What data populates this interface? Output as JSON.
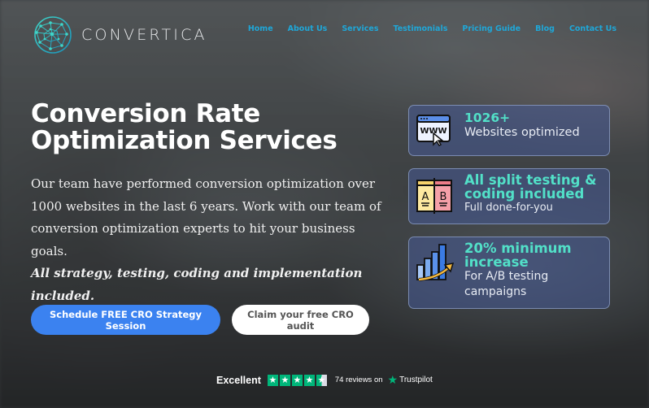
{
  "brand": {
    "name": "CONVERTICA",
    "logo_icon": "network-globe-icon"
  },
  "nav": {
    "items": [
      {
        "label": "Home"
      },
      {
        "label": "About Us"
      },
      {
        "label": "Services"
      },
      {
        "label": "Testimonials"
      },
      {
        "label": "Pricing Guide"
      },
      {
        "label": "Blog"
      },
      {
        "label": "Contact Us"
      }
    ],
    "color": "#1fa7d8"
  },
  "hero": {
    "title_line1": "Conversion Rate",
    "title_line2": "Optimization Services",
    "description": "Our team have performed conversion optimization over 1000 websites in the last 6 years. Work with our team of conversion optimization experts to hit your business goals.",
    "emphasis": "All strategy, testing, coding and implementation included.",
    "primary_button": "Schedule FREE CRO Strategy Session",
    "secondary_button": "Claim your free CRO audit",
    "primary_color": "#3b82f0"
  },
  "features": [
    {
      "icon": "www-browser-cursor-icon",
      "headline": "1026+",
      "subtext": "Websites optimized"
    },
    {
      "icon": "ab-test-icon",
      "headline_line1": "All split testing &",
      "headline_line2": "coding included",
      "subtext": "Full done-for-you"
    },
    {
      "icon": "growth-chart-icon",
      "headline_line1": "20% minimum",
      "headline_line2": "increase",
      "subtext_line1": "For A/B testing",
      "subtext_line2": "campaigns"
    }
  ],
  "trustpilot": {
    "rating_label": "Excellent",
    "rating_stars": 4.5,
    "star_glyph": "★",
    "reviews_text": "74 reviews on",
    "brand": "Trustpilot",
    "accent": "#00b67a"
  }
}
